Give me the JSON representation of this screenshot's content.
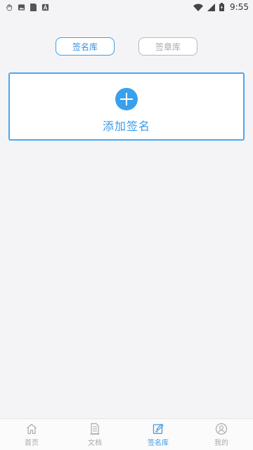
{
  "status_bar": {
    "time": "9:55",
    "left_icons": [
      "hand-icon",
      "image-icon",
      "sd-card-icon",
      "a-icon"
    ],
    "right_icons": [
      "wifi-icon",
      "signal-icon",
      "battery-icon"
    ]
  },
  "tabs": [
    {
      "label": "签名库",
      "active": true
    },
    {
      "label": "签章库",
      "active": false
    }
  ],
  "add_card": {
    "label": "添加签名",
    "icon": "plus-circle-icon"
  },
  "bottom_nav": [
    {
      "label": "首页",
      "icon": "home-icon",
      "active": false
    },
    {
      "label": "文档",
      "icon": "document-icon",
      "active": false
    },
    {
      "label": "签名库",
      "icon": "edit-signature-icon",
      "active": true
    },
    {
      "label": "我的",
      "icon": "user-icon",
      "active": false
    }
  ],
  "colors": {
    "accent": "#3aa0ee",
    "background": "#f4f4f6",
    "inactive": "#aaaaaa"
  }
}
